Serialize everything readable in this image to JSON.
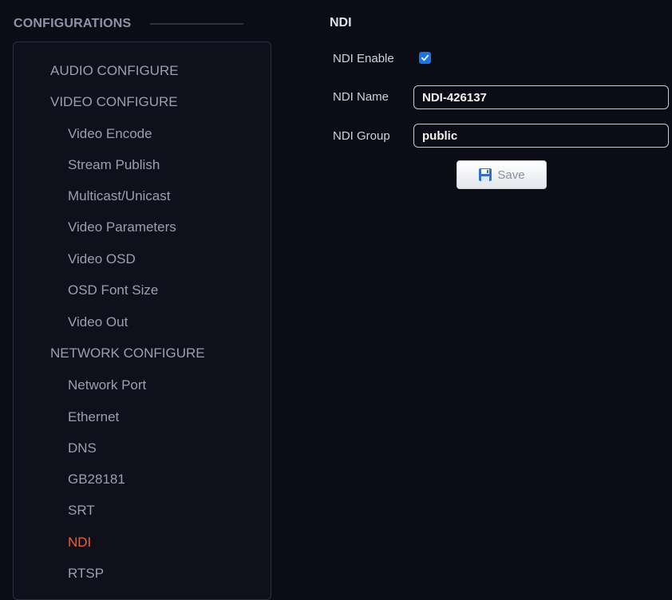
{
  "sidebar": {
    "header": "CONFIGURATIONS",
    "items": [
      {
        "label": "AUDIO CONFIGURE",
        "type": "section"
      },
      {
        "label": "VIDEO CONFIGURE",
        "type": "section"
      },
      {
        "label": "Video Encode",
        "type": "sub"
      },
      {
        "label": "Stream Publish",
        "type": "sub"
      },
      {
        "label": "Multicast/Unicast",
        "type": "sub"
      },
      {
        "label": "Video Parameters",
        "type": "sub"
      },
      {
        "label": "Video OSD",
        "type": "sub"
      },
      {
        "label": "OSD Font Size",
        "type": "sub"
      },
      {
        "label": "Video Out",
        "type": "sub"
      },
      {
        "label": "NETWORK CONFIGURE",
        "type": "section"
      },
      {
        "label": "Network Port",
        "type": "sub"
      },
      {
        "label": "Ethernet",
        "type": "sub"
      },
      {
        "label": "DNS",
        "type": "sub"
      },
      {
        "label": "GB28181",
        "type": "sub"
      },
      {
        "label": "SRT",
        "type": "sub"
      },
      {
        "label": "NDI",
        "type": "sub",
        "active": true
      },
      {
        "label": "RTSP",
        "type": "sub"
      }
    ]
  },
  "main": {
    "title": "NDI",
    "form": {
      "enable_label": "NDI Enable",
      "enable_checked": true,
      "name_label": "NDI Name",
      "name_value": "NDI-426137",
      "group_label": "NDI Group",
      "group_value": "public",
      "save_label": "Save"
    }
  },
  "colors": {
    "background": "#0c0c16",
    "active_item": "#ff5a1f",
    "checkbox": "#1a73e8"
  },
  "icons": {
    "save": "floppy-disk-icon",
    "checkbox": "checkmark-icon"
  }
}
